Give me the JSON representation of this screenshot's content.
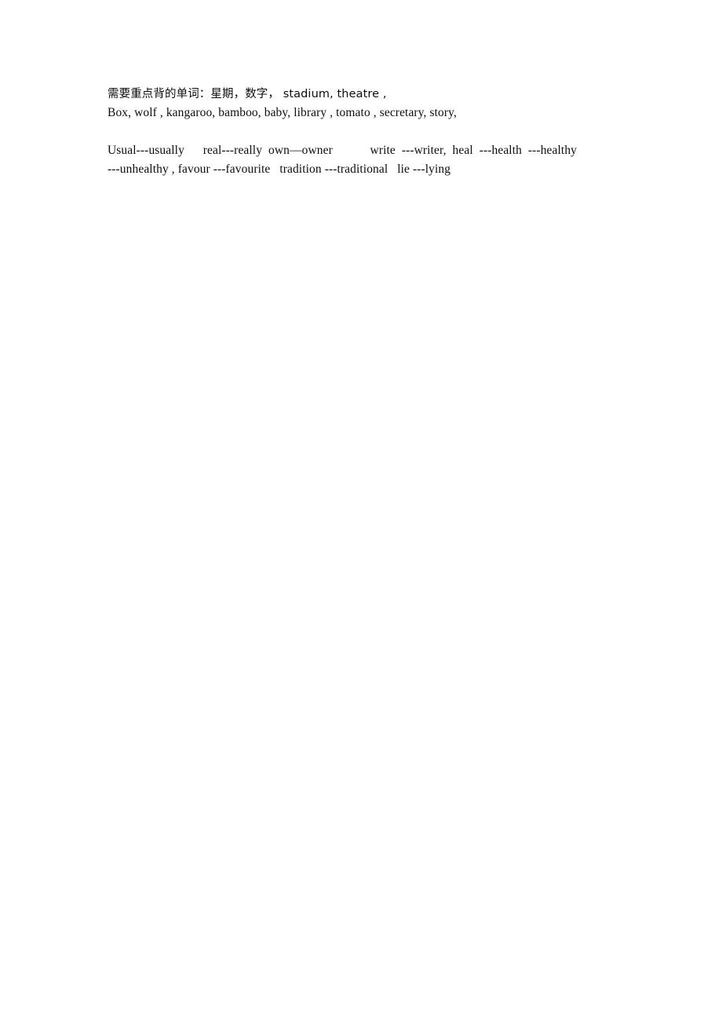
{
  "document": {
    "background_color": "#ffffff",
    "text_color": "#0d0d0d",
    "paragraphs": [
      {
        "id": "vocabulary-list",
        "lines": [
          "需要重点背的单词：星期，数字， stadium, theatre ,",
          "Box, wolf , kangaroo, bamboo, baby, library , tomato , secretary, story,"
        ]
      },
      {
        "id": "word-formation-list",
        "lines": [
          "Usual---usually      real---really  own—owner            write  ---writer,  heal  ---health  ---healthy",
          "---unhealthy , favour ---favourite   tradition ---traditional   lie ---lying"
        ]
      }
    ],
    "blank_separator": " "
  }
}
